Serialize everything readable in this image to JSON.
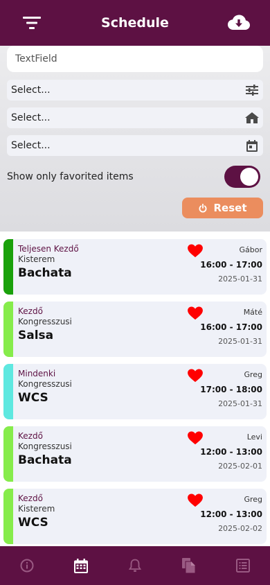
{
  "header": {
    "title": "Schedule",
    "left_icon": "filter-icon",
    "right_icon": "cloud-download-icon"
  },
  "filters": {
    "textfield_placeholder": "TextField",
    "selects": [
      {
        "label": "Select...",
        "icon": "tune-icon"
      },
      {
        "label": "Select...",
        "icon": "house-icon"
      },
      {
        "label": "Select...",
        "icon": "calendar-icon"
      }
    ],
    "favorites_label": "Show only favorited items",
    "favorites_on": true,
    "reset_label": "Reset"
  },
  "colors": {
    "primary": "#5d1143",
    "reset": "#eb8d5e",
    "heart": "#ff0000",
    "bar_dark_green": "#1aa10b",
    "bar_light_green": "#86ec4b",
    "bar_cyan": "#5ee8e0"
  },
  "events": [
    {
      "level": "Teljesen Kezdő",
      "room": "Kisterem",
      "dance": "Bachata",
      "teacher": "Gábor",
      "time": "16:00 - 17:00",
      "date": "2025-01-31",
      "bar_color": "#1aa10b",
      "favorite": true
    },
    {
      "level": "Kezdő",
      "room": "Kongresszusi",
      "dance": "Salsa",
      "teacher": "Máté",
      "time": "16:00 - 17:00",
      "date": "2025-01-31",
      "bar_color": "#86ec4b",
      "favorite": true
    },
    {
      "level": "Mindenki",
      "room": "Kongresszusi",
      "dance": "WCS",
      "teacher": "Greg",
      "time": "17:00 - 18:00",
      "date": "2025-01-31",
      "bar_color": "#5ee8e0",
      "favorite": true
    },
    {
      "level": "Kezdő",
      "room": "Kongresszusi",
      "dance": "Bachata",
      "teacher": "Levi",
      "time": "12:00 - 13:00",
      "date": "2025-02-01",
      "bar_color": "#86ec4b",
      "favorite": true
    },
    {
      "level": "Kezdő",
      "room": "Kisterem",
      "dance": "WCS",
      "teacher": "Greg",
      "time": "12:00 - 13:00",
      "date": "2025-02-02",
      "bar_color": "#86ec4b",
      "favorite": true
    }
  ],
  "bottom_nav": [
    {
      "icon": "info-icon",
      "active": false
    },
    {
      "icon": "calendar-icon",
      "active": true
    },
    {
      "icon": "bell-icon",
      "active": false
    },
    {
      "icon": "copy-icon",
      "active": false
    },
    {
      "icon": "list-icon",
      "active": false
    }
  ]
}
